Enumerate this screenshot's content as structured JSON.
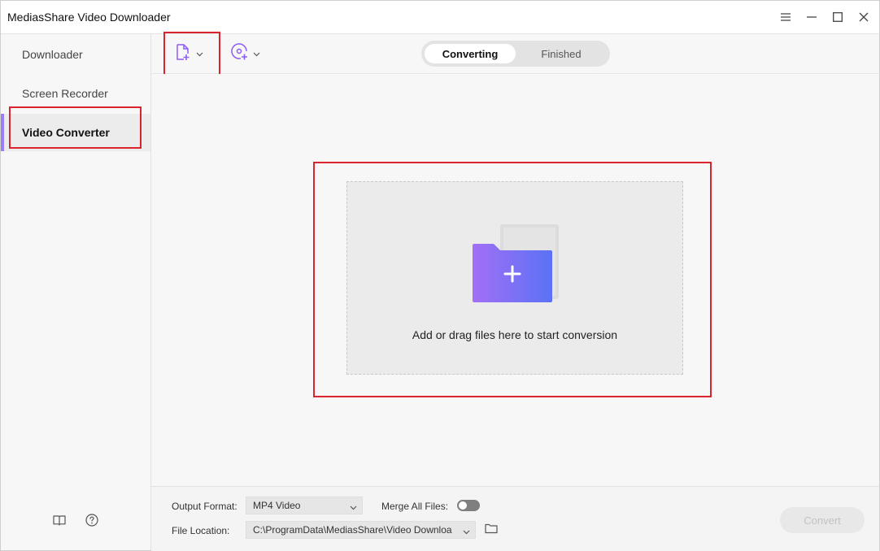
{
  "window": {
    "title": "MediasShare Video Downloader",
    "controls": [
      "menu-icon",
      "minimize-icon",
      "maximize-icon",
      "close-icon"
    ]
  },
  "sidebar": {
    "items": [
      {
        "label": "Downloader",
        "active": false
      },
      {
        "label": "Screen Recorder",
        "active": false
      },
      {
        "label": "Video Converter",
        "active": true
      }
    ],
    "footer_icons": [
      "book-icon",
      "help-icon"
    ]
  },
  "toolbar": {
    "add_file_icon": "add-file-icon",
    "add_disc_icon": "add-disc-icon",
    "tabs": [
      {
        "label": "Converting",
        "active": true
      },
      {
        "label": "Finished",
        "active": false
      }
    ]
  },
  "dropzone": {
    "icon": "folder-plus-icon",
    "text": "Add or drag files here to start conversion"
  },
  "bottom": {
    "output_format_label": "Output Format:",
    "output_format_value": "MP4 Video",
    "merge_label": "Merge All Files:",
    "merge_on": false,
    "file_location_label": "File Location:",
    "file_location_value": "C:\\ProgramData\\MediasShare\\Video Downloa",
    "convert_label": "Convert"
  },
  "colors": {
    "accent": "#9b7ff2",
    "highlight": "#d9232d",
    "folder_gradient_start": "#a26ff5",
    "folder_gradient_end": "#5b72f5"
  }
}
